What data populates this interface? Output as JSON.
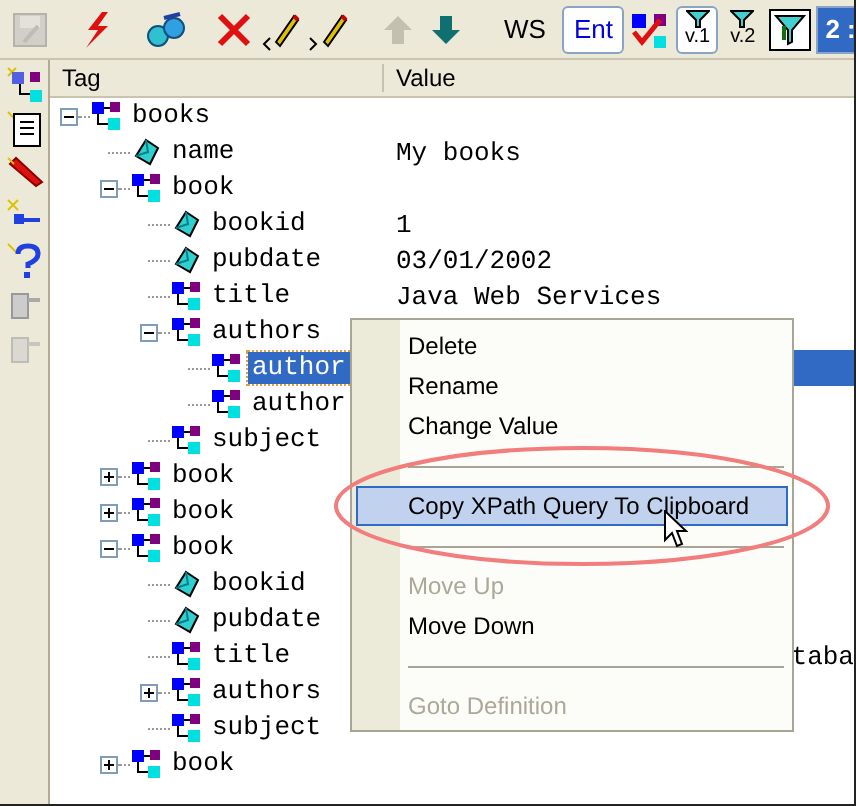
{
  "toolbar": [
    {
      "kind": "icon",
      "disabled": true
    },
    {
      "kind": "separator"
    },
    {
      "kind": "icon",
      "disabled": false
    },
    {
      "kind": "separator"
    },
    {
      "kind": "icon",
      "disabled": false
    },
    {
      "kind": "separator"
    },
    {
      "kind": "icon",
      "disabled": false
    },
    {
      "kind": "icon",
      "disabled": false
    },
    {
      "kind": "icon",
      "disabled": false
    },
    {
      "kind": "separator"
    },
    {
      "kind": "icon",
      "disabled": true
    },
    {
      "kind": "icon",
      "disabled": false
    },
    {
      "kind": "separator"
    },
    {
      "kind": "text",
      "label": "WS",
      "pressed": false
    },
    {
      "kind": "text",
      "label": "Ent",
      "pressed": true
    },
    {
      "kind": "icon",
      "disabled": false
    },
    {
      "kind": "filter",
      "label": "v.1",
      "pressed": true
    },
    {
      "kind": "filter",
      "label": "v.2",
      "pressed": false
    },
    {
      "kind": "icon",
      "disabled": false
    },
    {
      "kind": "tab",
      "label": "2 :"
    }
  ],
  "side_toolbar": [
    {
      "disabled": false
    },
    {
      "disabled": false
    },
    {
      "disabled": false
    },
    {
      "disabled": false
    },
    {
      "disabled": false
    },
    {
      "disabled": false
    },
    {
      "disabled": true
    }
  ],
  "columns": [
    "Tag",
    "Value"
  ],
  "tree": [
    {
      "kind": "element",
      "tag": "books",
      "expanded": true,
      "selected": false,
      "children": [
        {
          "kind": "attribute",
          "tag": "name",
          "value": "My books",
          "selected": false
        },
        {
          "kind": "element",
          "tag": "book",
          "expanded": true,
          "selected": false,
          "children": [
            {
              "kind": "attribute",
              "tag": "bookid",
              "value": "1",
              "selected": false
            },
            {
              "kind": "attribute",
              "tag": "pubdate",
              "value": "03/01/2002",
              "selected": false
            },
            {
              "kind": "element",
              "tag": "title",
              "value": "Java Web Services",
              "selected": false
            },
            {
              "kind": "element",
              "tag": "authors",
              "expanded": true,
              "selected": false,
              "children": [
                {
                  "kind": "element",
                  "tag": "author",
                  "selected": true
                },
                {
                  "kind": "element",
                  "tag": "author",
                  "selected": false
                }
              ]
            },
            {
              "kind": "element",
              "tag": "subject",
              "selected": false
            }
          ]
        },
        {
          "kind": "element",
          "tag": "book",
          "expanded": false,
          "selected": false
        },
        {
          "kind": "element",
          "tag": "book",
          "expanded": false,
          "selected": false
        },
        {
          "kind": "element",
          "tag": "book",
          "expanded": true,
          "selected": false,
          "children": [
            {
              "kind": "attribute",
              "tag": "bookid",
              "selected": false
            },
            {
              "kind": "attribute",
              "tag": "pubdate",
              "selected": false
            },
            {
              "kind": "element",
              "tag": "title",
              "value": "taba",
              "partly_covered": true,
              "selected": false
            },
            {
              "kind": "element",
              "tag": "authors",
              "expanded": false,
              "selected": false
            },
            {
              "kind": "element",
              "tag": "subject",
              "selected": false
            }
          ]
        },
        {
          "kind": "element",
          "tag": "book",
          "expanded": false,
          "selected": false
        }
      ]
    }
  ],
  "context_menu": [
    {
      "kind": "item",
      "label": "Delete",
      "selected": false,
      "disabled": false
    },
    {
      "kind": "item",
      "label": "Rename",
      "selected": false,
      "disabled": false
    },
    {
      "kind": "item",
      "label": "Change Value",
      "selected": false,
      "disabled": false
    },
    {
      "kind": "separator"
    },
    {
      "kind": "item",
      "label": "Copy XPath Query To Clipboard",
      "selected": true,
      "disabled": false
    },
    {
      "kind": "separator"
    },
    {
      "kind": "item",
      "label": "Move Up",
      "selected": false,
      "disabled": true
    },
    {
      "kind": "item",
      "label": "Move Down",
      "selected": false,
      "disabled": false
    },
    {
      "kind": "separator"
    },
    {
      "kind": "item",
      "label": "Goto Definition",
      "selected": false,
      "disabled": true
    }
  ]
}
